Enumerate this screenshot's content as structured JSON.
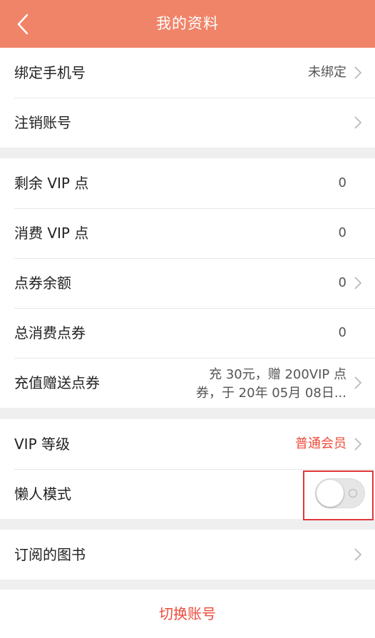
{
  "header": {
    "title": "我的资料",
    "back_icon": "chevron-left-icon"
  },
  "account": {
    "bind_phone_label": "绑定手机号",
    "bind_phone_value": "未绑定",
    "cancel_account_label": "注销账号"
  },
  "vip": {
    "remaining_points_label": "剩余 VIP 点",
    "remaining_points_value": "0",
    "consumed_points_label": "消费 VIP 点",
    "consumed_points_value": "0",
    "voucher_balance_label": "点券余额",
    "voucher_balance_value": "0",
    "total_voucher_label": "总消费点券",
    "total_voucher_value": "0",
    "recharge_label": "充值赠送点券",
    "recharge_value_line1": "充 30元，赠 200VIP 点",
    "recharge_value_line2": "券，于 20年 05月 08日..."
  },
  "settings": {
    "vip_level_label": "VIP 等级",
    "vip_level_value": "普通会员",
    "lazy_mode_label": "懒人模式",
    "lazy_mode_on": false
  },
  "books": {
    "subscribed_label": "订阅的图书"
  },
  "footer": {
    "switch_account_label": "切换账号"
  },
  "colors": {
    "header": "#ef8469",
    "accent": "#ee4a3a",
    "highlight": "#e0373a"
  }
}
